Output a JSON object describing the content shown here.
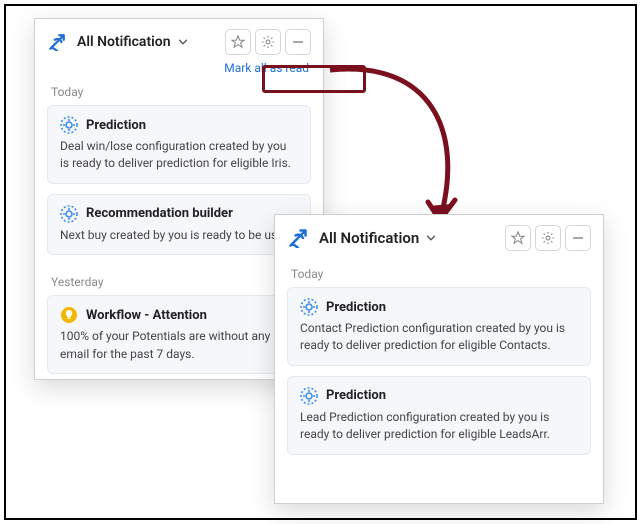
{
  "colors": {
    "accent": "#1f6fd6",
    "highlight": "#7a0f1e",
    "iconBlue": "#3e8df0",
    "iconYellow": "#f2b705"
  },
  "icons": {
    "star": "star-icon",
    "gear": "gear-icon",
    "minus": "minus-icon",
    "chevronDown": "chevron-down-icon",
    "predictionGear": "prediction-gear-icon",
    "bulb": "bulb-icon"
  },
  "panel_a": {
    "dropdown_label": "All Notification",
    "mark_all": "Mark all as read",
    "sections": [
      {
        "label": "Today",
        "items": [
          {
            "icon": "predictionGear",
            "title": "Prediction",
            "body": "Deal win/lose configuration created by you is ready to deliver prediction for eligible Iris."
          },
          {
            "icon": "predictionGear",
            "title": "Recommendation builder",
            "body": "Next buy created by you is ready to be used."
          }
        ]
      },
      {
        "label": "Yesterday",
        "items": [
          {
            "icon": "bulb",
            "title": "Workflow - Attention",
            "body": "100% of your Potentials are without any email for the past 7 days."
          }
        ]
      }
    ]
  },
  "panel_b": {
    "dropdown_label": "All Notification",
    "sections": [
      {
        "label": "Today",
        "items": [
          {
            "icon": "predictionGear",
            "title": "Prediction",
            "body": "Contact Prediction configuration created by you is ready to deliver prediction for eligible Contacts."
          },
          {
            "icon": "predictionGear",
            "title": "Prediction",
            "body": "Lead Prediction configuration created by you is ready to deliver prediction for eligible LeadsArr."
          }
        ]
      }
    ]
  }
}
